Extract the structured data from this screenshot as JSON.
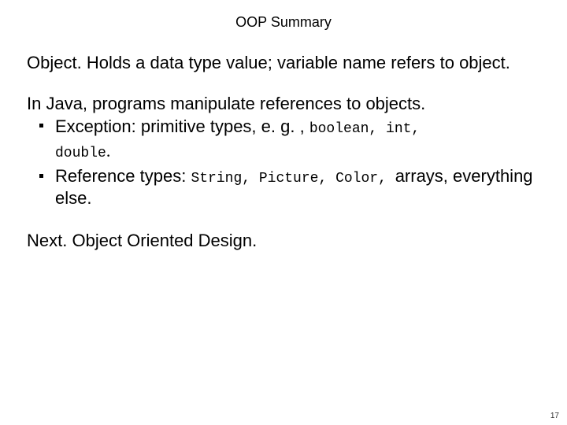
{
  "slide": {
    "title": "OOP Summary",
    "p1_a": "Object.",
    "p1_b": "  Holds a data type value; variable name refers to object.",
    "p2_lead": "In Java, programs manipulate references to objects.",
    "b1_a": "Exception:  primitive types, e. g. , ",
    "b1_code": "boolean, int,",
    "b1_cont_code": "double",
    "b1_cont_dot": ". ",
    "b2_a": "Reference types:  ",
    "b2_code": "String, Picture, Color, ",
    "b2_b": "arrays, everything else.",
    "p3_a": "Next.",
    "p3_b": "  Object Oriented Design.",
    "page_no": "17"
  }
}
